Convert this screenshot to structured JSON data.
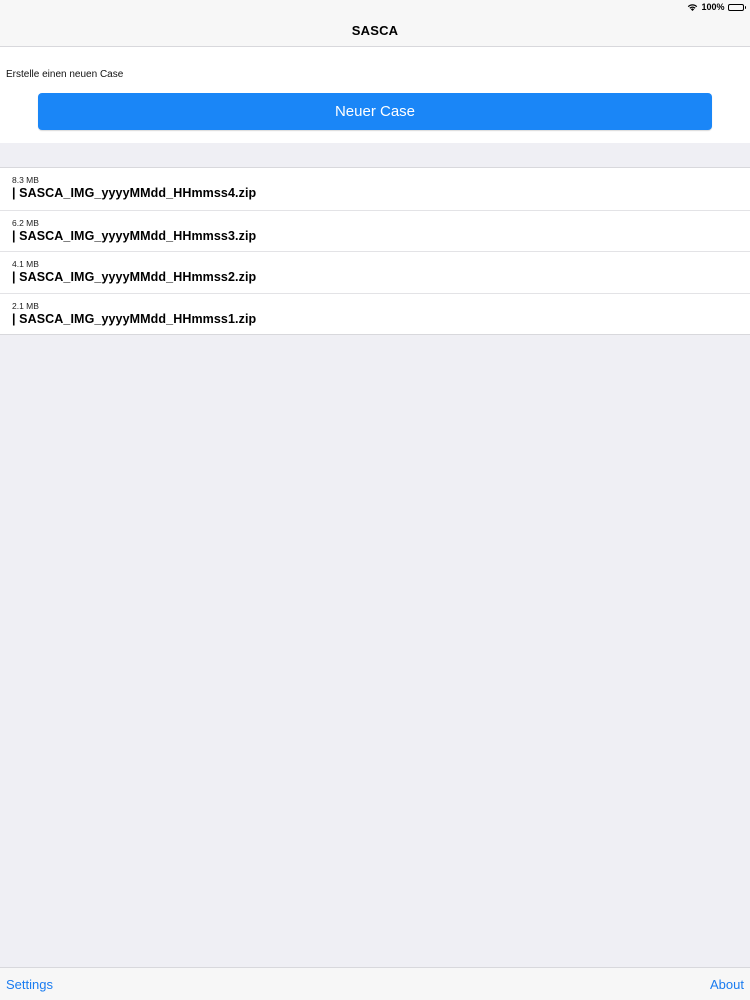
{
  "status_bar": {
    "battery_text": "100%",
    "wifi_icon": "wifi-icon",
    "battery_icon": "battery-icon"
  },
  "nav": {
    "title": "SASCA"
  },
  "new_case": {
    "label": "Erstelle einen neuen Case",
    "button_label": "Neuer Case",
    "button_color": "#1a86f7"
  },
  "files": [
    {
      "size": "8.3 MB",
      "name": "| SASCA_IMG_yyyyMMdd_HHmmss4.zip"
    },
    {
      "size": "6.2 MB",
      "name": "| SASCA_IMG_yyyyMMdd_HHmmss3.zip"
    },
    {
      "size": "4.1 MB",
      "name": "| SASCA_IMG_yyyyMMdd_HHmmss2.zip"
    },
    {
      "size": "2.1 MB",
      "name": "| SASCA_IMG_yyyyMMdd_HHmmss1.zip"
    }
  ],
  "toolbar": {
    "settings_label": "Settings",
    "about_label": "About",
    "link_color": "#1a7cf0"
  }
}
